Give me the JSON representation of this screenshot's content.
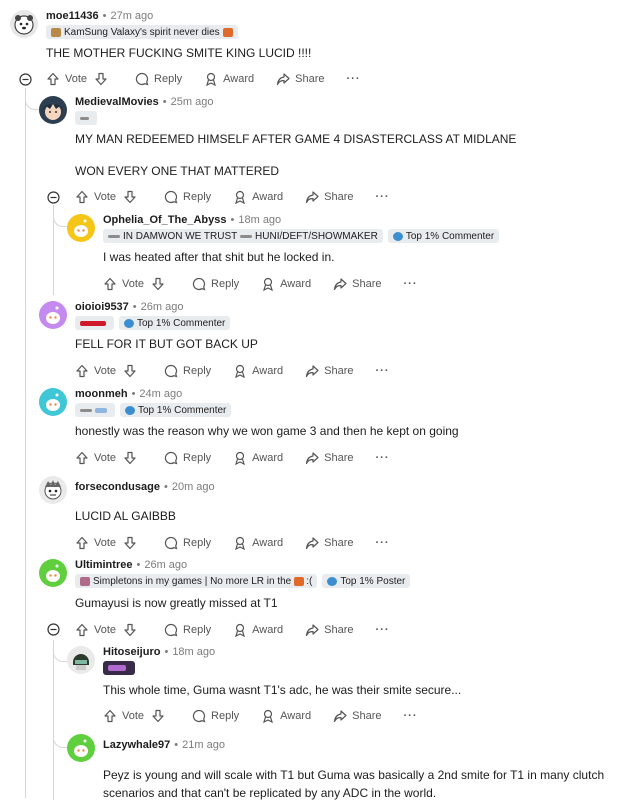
{
  "actions": {
    "vote": "Vote",
    "reply": "Reply",
    "award": "Award",
    "share": "Share",
    "more": "···"
  },
  "comments": [
    {
      "user": "moe11436",
      "time": "27m ago",
      "flairs": [
        "KamSung Valaxy's spirit never dies"
      ],
      "body": [
        "THE MOTHER FUCKING SMITE KING LUCID !!!!"
      ],
      "avatar": "bear-icon"
    },
    {
      "user": "MedievalMovies",
      "time": "25m ago",
      "flairs": [
        ""
      ],
      "body": [
        "MY MAN REDEEMED HIMSELF AFTER GAME 4 DISASTERCLASS AT MIDLANE",
        "WON EVERY ONE THAT MATTERED"
      ],
      "avatar": "anime-avatar"
    },
    {
      "user": "Ophelia_Of_The_Abyss",
      "time": "18m ago",
      "flairs": [
        "IN DAMWON WE TRUST",
        "HUNI/DEFT/SHOWMAKER",
        "Top 1% Commenter"
      ],
      "body": [
        "I was heated after that shit but he locked in."
      ],
      "avatar": "snoo-avatar-yellow"
    },
    {
      "user": "oioioi9537",
      "time": "26m ago",
      "flairs": [
        "",
        "Top 1% Commenter"
      ],
      "body": [
        "FELL FOR IT BUT GOT BACK UP"
      ],
      "avatar": "snoo-avatar-purple"
    },
    {
      "user": "moonmeh",
      "time": "24m ago",
      "flairs": [
        "",
        "Top 1% Commenter"
      ],
      "body": [
        "honestly was the reason why we won game 3 and then he kept on going"
      ],
      "avatar": "snoo-avatar-teal"
    },
    {
      "user": "forsecondusage",
      "time": "20m ago",
      "flairs": [],
      "body": [
        "LUCID AL GAIBBB"
      ],
      "avatar": "character-avatar"
    },
    {
      "user": "Ultimintree",
      "time": "26m ago",
      "flairs": [
        "Simpletons in my games | No more LR in the",
        "Top 1% Poster"
      ],
      "body": [
        "Gumayusi is now greatly missed at T1"
      ],
      "avatar": "snoo-avatar-green"
    },
    {
      "user": "Hitoseijuro",
      "time": "18m ago",
      "flairs": [
        ""
      ],
      "body": [
        "This whole time, Guma wasnt T1's adc, he was their smite secure..."
      ],
      "avatar": "helmet-avatar"
    },
    {
      "user": "Lazywhale97",
      "time": "21m ago",
      "flairs": [],
      "body": [
        "Peyz is young and will scale with T1 but Guma was basically a 2nd smite for T1 in many clutch",
        "scenarios and that can't be replicated by any ADC in the world."
      ],
      "avatar": "snoo-avatar-green"
    }
  ],
  "colors": {
    "thread_line": "#d6d6d6",
    "flair_bg": "#e9ecef",
    "meta": "#7c7c7c",
    "top_badge": "#3b8fd0"
  }
}
